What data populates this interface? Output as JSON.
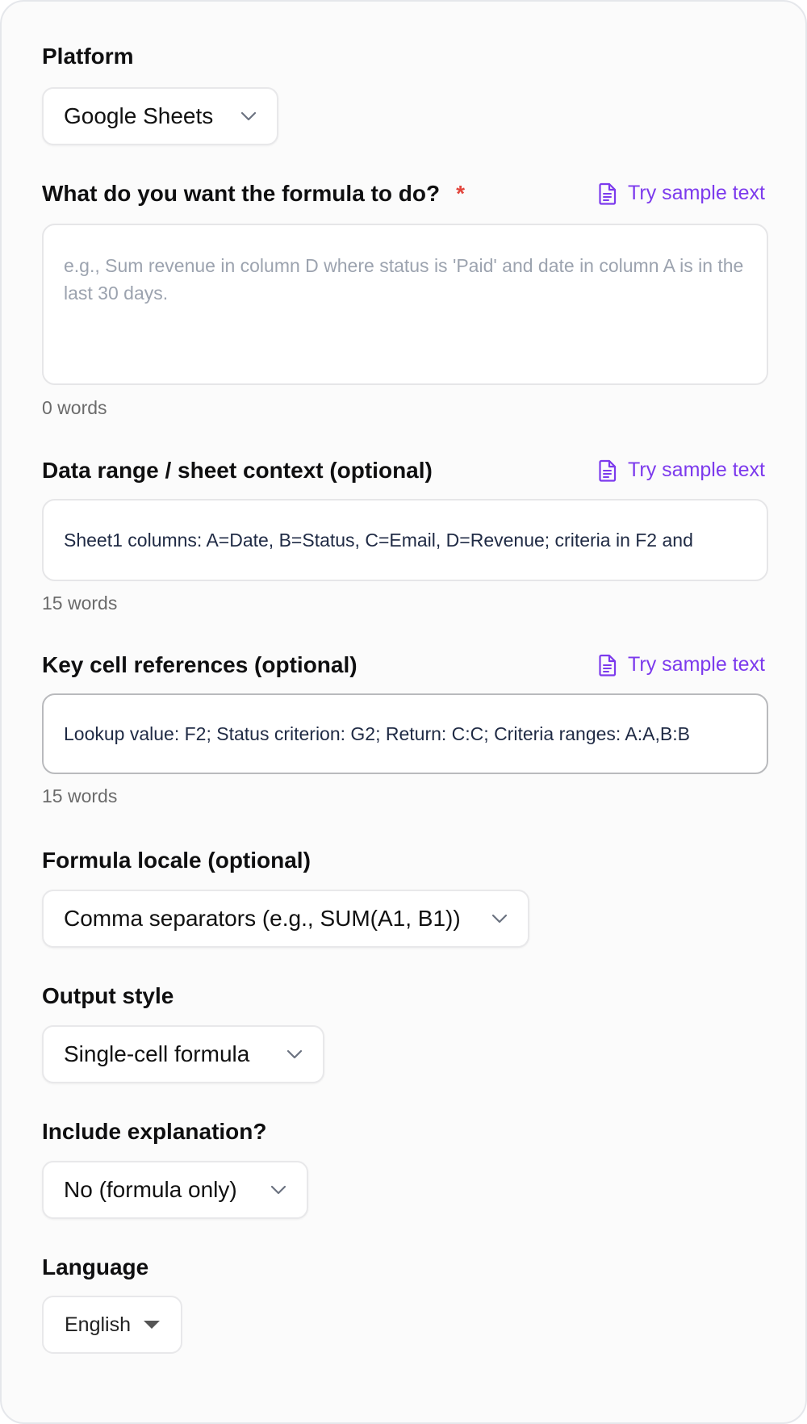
{
  "form": {
    "platform": {
      "label": "Platform",
      "value": "Google Sheets"
    },
    "task": {
      "label": "What do you want the formula to do?",
      "required_mark": "*",
      "sample_link": "Try sample text",
      "placeholder": "e.g., Sum revenue in column D where status is 'Paid' and date in column A is in the last 30 days.",
      "value": "",
      "word_count": "0 words"
    },
    "context": {
      "label": "Data range / sheet context (optional)",
      "sample_link": "Try sample text",
      "value": "Sheet1 columns: A=Date, B=Status, C=Email, D=Revenue; criteria in F2 and",
      "word_count": "15 words"
    },
    "refs": {
      "label": "Key cell references (optional)",
      "sample_link": "Try sample text",
      "value": "Lookup value: F2; Status criterion: G2; Return: C:C; Criteria ranges: A:A,B:B",
      "word_count": "15 words"
    },
    "locale": {
      "label": "Formula locale (optional)",
      "value": "Comma separators (e.g., SUM(A1, B1))"
    },
    "output": {
      "label": "Output style",
      "value": "Single-cell formula"
    },
    "explanation": {
      "label": "Include explanation?",
      "value": "No (formula only)"
    },
    "language": {
      "label": "Language",
      "value": "English"
    }
  },
  "colors": {
    "accent": "#7c3aed",
    "required": "#e2453c",
    "placeholder": "#9ca3af",
    "input_text": "#1f2a44"
  },
  "icons": {
    "sample": "document-icon",
    "chevron": "chevron-down-icon",
    "caret": "caret-down-icon"
  }
}
